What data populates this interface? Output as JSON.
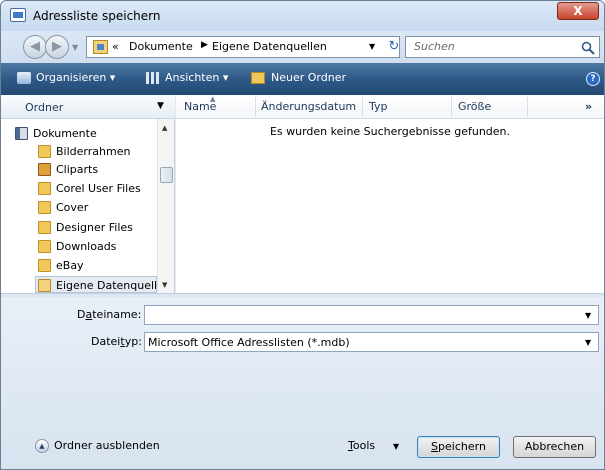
{
  "window": {
    "title": "Adressliste speichern",
    "close_label": "X"
  },
  "address": {
    "overflow": "«",
    "crumbs": [
      "Dokumente",
      "Eigene Datenquellen"
    ],
    "separator": "▶"
  },
  "search": {
    "placeholder": "Suchen"
  },
  "toolbar": {
    "organize": "Organisieren ▾",
    "views": "Ansichten ▾",
    "new_folder": "Neuer Ordner",
    "help": "?"
  },
  "sidebar": {
    "header": "Ordner",
    "items": [
      {
        "label": "Dokumente",
        "icon": "documents-icon"
      },
      {
        "label": "Bilderrahmen",
        "icon": "folder-icon"
      },
      {
        "label": "Cliparts",
        "icon": "clipart-folder-icon"
      },
      {
        "label": "Corel User Files",
        "icon": "folder-icon"
      },
      {
        "label": "Cover",
        "icon": "folder-icon"
      },
      {
        "label": "Designer Files",
        "icon": "folder-icon"
      },
      {
        "label": "Downloads",
        "icon": "folder-icon"
      },
      {
        "label": "eBay",
        "icon": "folder-icon"
      },
      {
        "label": "Eigene Datenquell",
        "icon": "data-sources-folder-icon"
      }
    ]
  },
  "columns": [
    "Name",
    "Änderungsdatum",
    "Typ",
    "Größe"
  ],
  "columns_more": "»",
  "empty_message": "Es wurden keine Suchergebnisse gefunden.",
  "form": {
    "filename_label_pre": "D",
    "filename_label_ul": "a",
    "filename_label_post": "teiname:",
    "filename_value": "",
    "filetype_label_pre": "Datei",
    "filetype_label_ul": "t",
    "filetype_label_post": "yp:",
    "filetype_value": "Microsoft Office Adresslisten (*.mdb)"
  },
  "footer": {
    "hide_folders": "Ordner ausblenden",
    "tools_ul": "T",
    "tools_rest": "ools",
    "save_ul": "S",
    "save_rest": "peichern",
    "cancel": "Abbrechen"
  },
  "colors": {
    "toolbar": "#2f5a87",
    "close": "#c8452d",
    "window_bg": "#dfe9f3"
  }
}
